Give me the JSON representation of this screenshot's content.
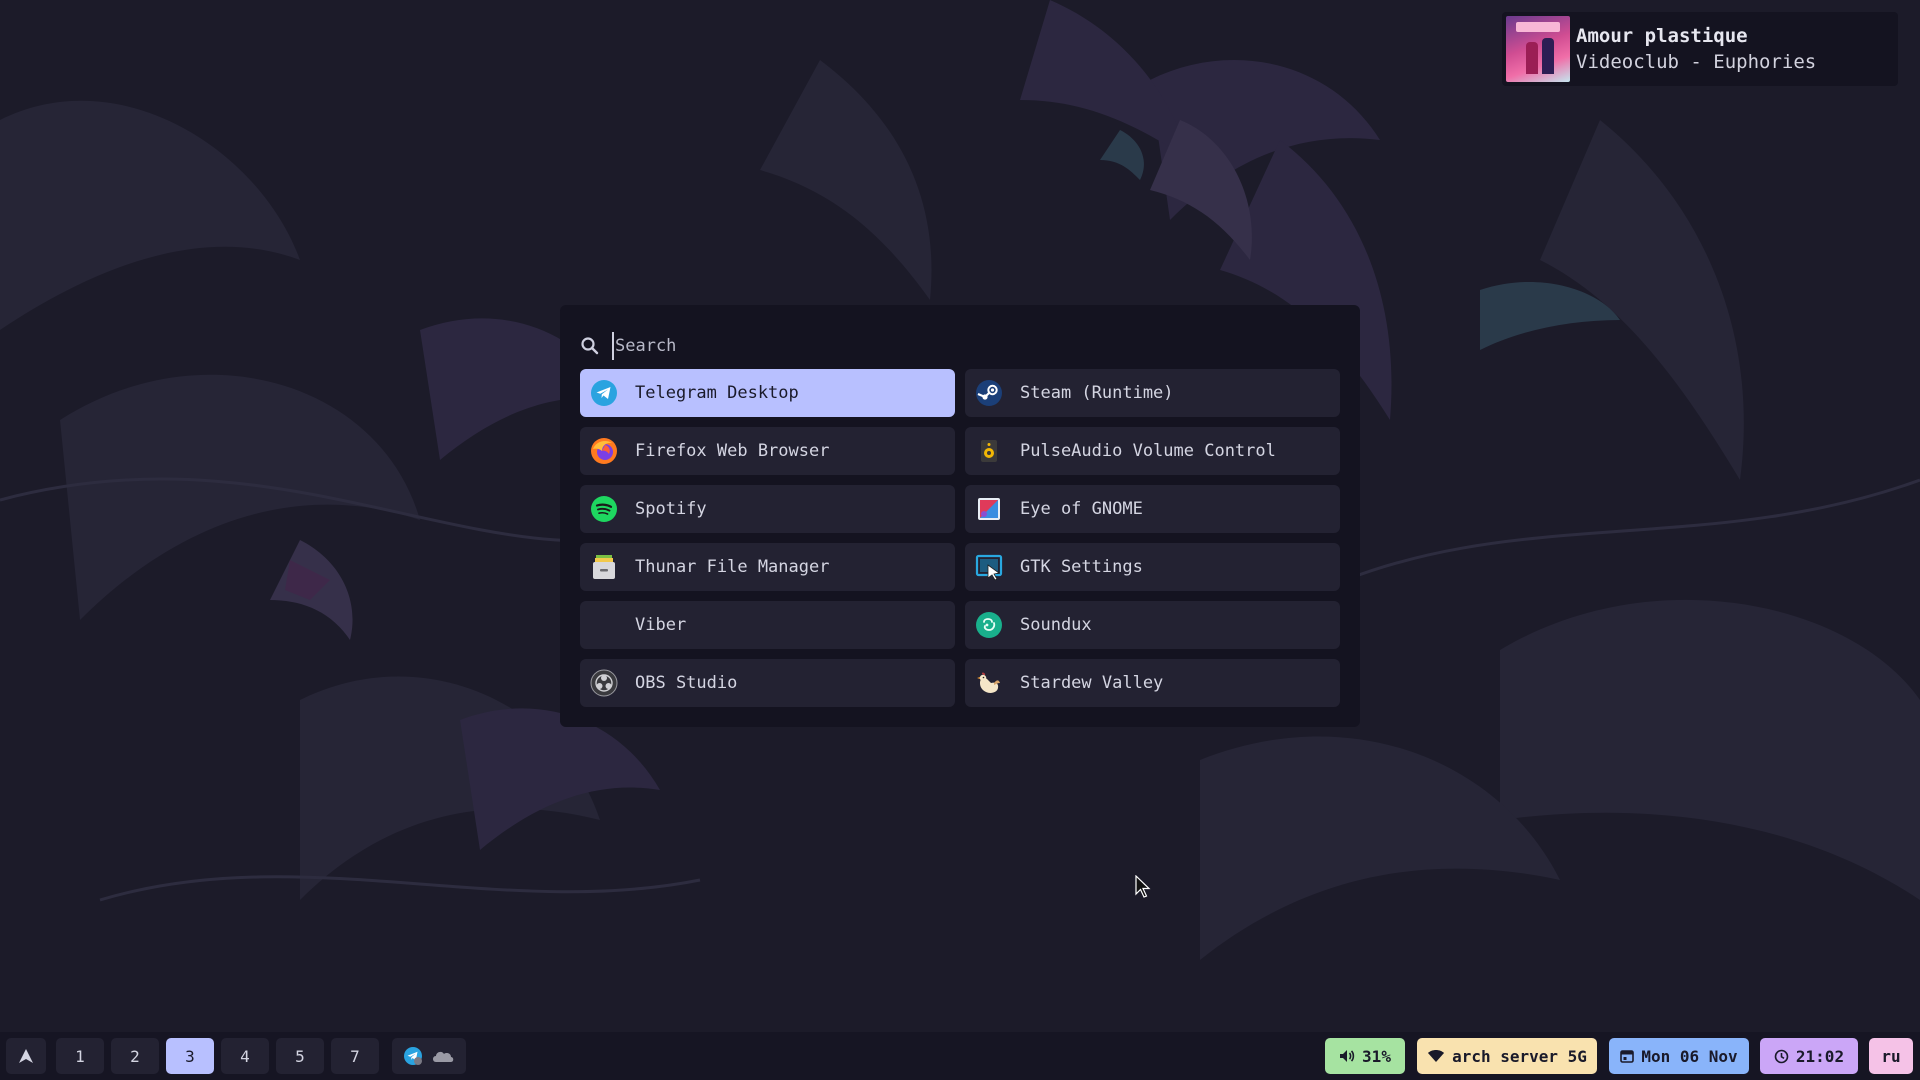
{
  "now_playing": {
    "title": "Amour plastique",
    "artist": "Videoclub - Euphories"
  },
  "launcher": {
    "search": {
      "placeholder": "Search",
      "value": ""
    },
    "apps": [
      {
        "label": "Telegram Desktop",
        "icon": "telegram-icon",
        "selected": true
      },
      {
        "label": "Steam (Runtime)",
        "icon": "steam-icon"
      },
      {
        "label": "Firefox Web Browser",
        "icon": "firefox-icon"
      },
      {
        "label": "PulseAudio Volume Control",
        "icon": "speaker-icon"
      },
      {
        "label": "Spotify",
        "icon": "spotify-icon"
      },
      {
        "label": "Eye of GNOME",
        "icon": "image-viewer-icon"
      },
      {
        "label": "Thunar File Manager",
        "icon": "file-cabinet-icon"
      },
      {
        "label": "GTK Settings",
        "icon": "gtk-settings-icon"
      },
      {
        "label": "Viber",
        "icon": ""
      },
      {
        "label": "Soundux",
        "icon": "soundux-icon"
      },
      {
        "label": "OBS Studio",
        "icon": "obs-icon"
      },
      {
        "label": "Stardew Valley",
        "icon": "chicken-icon"
      }
    ]
  },
  "bar": {
    "workspaces": [
      "1",
      "2",
      "3",
      "4",
      "5",
      "7"
    ],
    "active_workspace": "3",
    "volume": "31%",
    "wifi": "arch server 5G",
    "date": "Mon 06 Nov",
    "time": "21:02",
    "language": "ru"
  },
  "colors": {
    "accent": "#b8c0ff",
    "volume_pill": "#a6e3a1",
    "wifi_pill": "#f9e2af",
    "date_pill": "#89b4fa",
    "time_pill": "#cba6f7",
    "lang_pill": "#f5c2e7"
  }
}
